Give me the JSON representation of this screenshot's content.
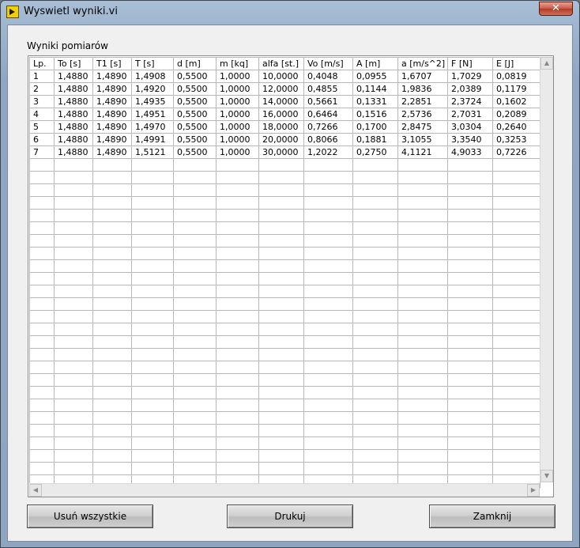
{
  "window": {
    "title": "Wyswietl wyniki.vi",
    "close_label": "✕"
  },
  "table": {
    "label": "Wyniki pomiarów",
    "columns": [
      "Lp.",
      "To [s]",
      "T1 [s]",
      "T [s]",
      "d [m]",
      "m [kq]",
      "alfa [st.]",
      "Vo [m/s]",
      "A [m]",
      "a [m/s^2]",
      "F [N]",
      "E [J]"
    ],
    "rows": [
      [
        "1",
        "1,4880",
        "1,4890",
        "1,4908",
        "0,5500",
        "1,0000",
        "10,0000",
        "0,4048",
        "0,0955",
        "1,6707",
        "1,7029",
        "0,0819"
      ],
      [
        "2",
        "1,4880",
        "1,4890",
        "1,4920",
        "0,5500",
        "1,0000",
        "12,0000",
        "0,4855",
        "0,1144",
        "1,9836",
        "2,0389",
        "0,1179"
      ],
      [
        "3",
        "1,4880",
        "1,4890",
        "1,4935",
        "0,5500",
        "1,0000",
        "14,0000",
        "0,5661",
        "0,1331",
        "2,2851",
        "2,3724",
        "0,1602"
      ],
      [
        "4",
        "1,4880",
        "1,4890",
        "1,4951",
        "0,5500",
        "1,0000",
        "16,0000",
        "0,6464",
        "0,1516",
        "2,5736",
        "2,7031",
        "0,2089"
      ],
      [
        "5",
        "1,4880",
        "1,4890",
        "1,4970",
        "0,5500",
        "1,0000",
        "18,0000",
        "0,7266",
        "0,1700",
        "2,8475",
        "3,0304",
        "0,2640"
      ],
      [
        "6",
        "1,4880",
        "1,4890",
        "1,4991",
        "0,5500",
        "1,0000",
        "20,0000",
        "0,8066",
        "0,1881",
        "3,1055",
        "3,3540",
        "0,3253"
      ],
      [
        "7",
        "1,4880",
        "1,4890",
        "1,5121",
        "0,5500",
        "1,0000",
        "30,0000",
        "1,2022",
        "0,2750",
        "4,1121",
        "4,9033",
        "0,7226"
      ]
    ]
  },
  "buttons": {
    "clear_all": "Usuń wszystkie",
    "print": "Drukuj",
    "close": "Zamknij"
  },
  "icons": {
    "app": "labview-vi-icon",
    "close": "close-icon",
    "scroll_up": "chevron-up-icon",
    "scroll_down": "chevron-down-icon",
    "scroll_left": "chevron-left-icon",
    "scroll_right": "chevron-right-icon"
  }
}
